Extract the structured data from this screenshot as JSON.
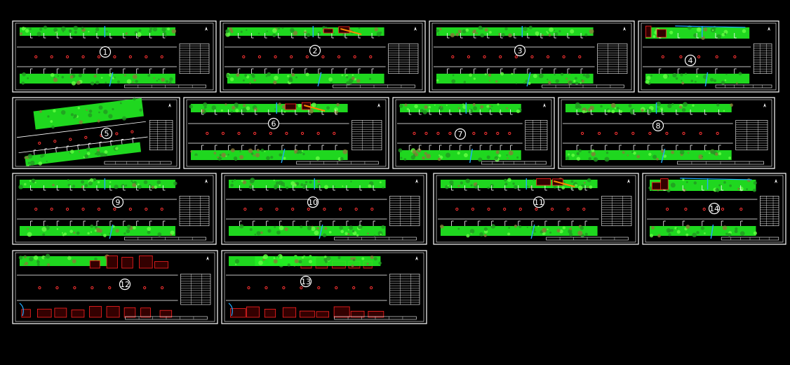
{
  "drawing": {
    "background": "#000000",
    "colors": {
      "frame": "#ffffff",
      "vegetation": "#22ee22",
      "vegetation_dark": "#229922",
      "vegetation_brown": "#8a7a3a",
      "road_line": "#ffffff",
      "tree_marker": "#ff3333",
      "water": "#22aaff",
      "building": "#ff2222",
      "annotation": "#ff8800",
      "title_block": "#ffffff"
    },
    "sheets": [
      {
        "label": "1"
      },
      {
        "label": "2"
      },
      {
        "label": "3"
      },
      {
        "label": "4"
      },
      {
        "label": "5"
      },
      {
        "label": "6"
      },
      {
        "label": "7"
      },
      {
        "label": "8"
      },
      {
        "label": "9"
      },
      {
        "label": "10"
      },
      {
        "label": "11"
      },
      {
        "label": "14"
      },
      {
        "label": "12"
      },
      {
        "label": "13"
      }
    ]
  }
}
